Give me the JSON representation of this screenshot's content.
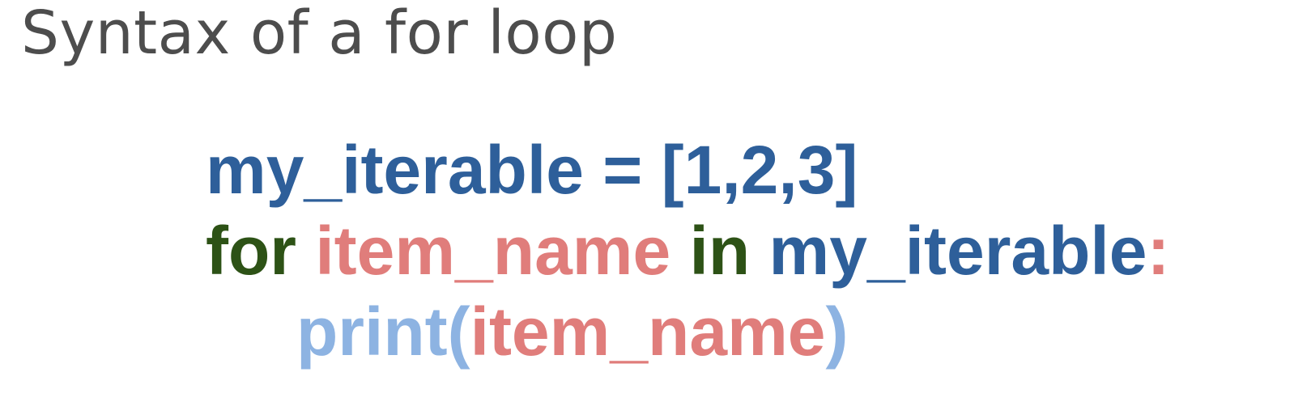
{
  "title": {
    "text": "Syntax of a for loop",
    "color": "#4d4d4d"
  },
  "colors": {
    "variable": "#2e5f9a",
    "keyword": "#2d5216",
    "loop_var": "#e07d7b",
    "builtin": "#8db3e2"
  },
  "code": {
    "line1": {
      "lhs": "my_iterable",
      "op": " = ",
      "value": "[1,2,3]"
    },
    "line2": {
      "kw_for": "for",
      "sp1": " ",
      "var": "item_name",
      "sp2": " ",
      "kw_in": "in",
      "sp3": " ",
      "iterable": "my_iterable",
      "colon": ":"
    },
    "line3": {
      "func": "print",
      "open_paren": "(",
      "arg": "item_name",
      "close_paren": ")"
    }
  }
}
